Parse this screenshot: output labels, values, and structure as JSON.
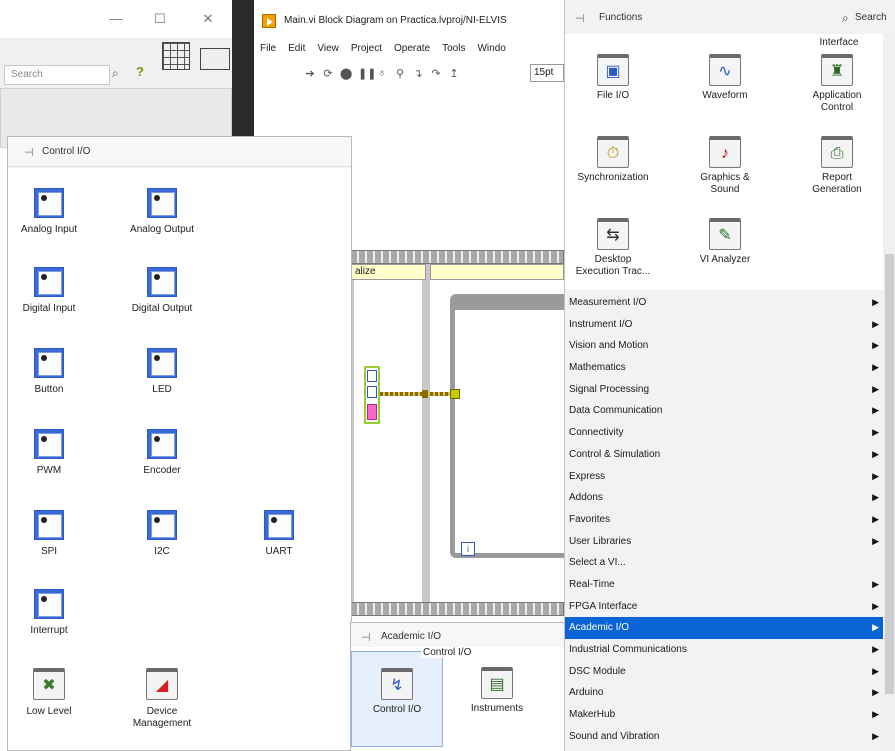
{
  "left_window": {
    "search_placeholder": "Search",
    "min_icon": "minimize-icon",
    "max_icon": "maximize-icon",
    "close_icon": "close-icon"
  },
  "block_diagram": {
    "title": "Main.vi Block Diagram on Practica.lvproj/NI-ELVIS",
    "menus": [
      "File",
      "Edit",
      "View",
      "Project",
      "Operate",
      "Tools",
      "Windo"
    ],
    "font_size": "15pt",
    "frame1_label": "alize",
    "loop_iteration": "i"
  },
  "control_palette": {
    "title": "Control I/O",
    "items": [
      {
        "label": "Analog Input",
        "glyph": "⌁"
      },
      {
        "label": "Analog Output",
        "glyph": "⌁"
      },
      {
        "label": "Digital Input",
        "glyph": "⊓"
      },
      {
        "label": "Digital Output",
        "glyph": "⊓"
      },
      {
        "label": "Button",
        "glyph": "●"
      },
      {
        "label": "LED",
        "glyph": "●"
      },
      {
        "label": "PWM",
        "glyph": "⊓"
      },
      {
        "label": "Encoder",
        "glyph": "E/D"
      },
      {
        "label": "SPI",
        "glyph": "SPI"
      },
      {
        "label": "I2C",
        "glyph": "I2C"
      },
      {
        "label": "UART",
        "glyph": "UART"
      },
      {
        "label": "Interrupt",
        "glyph": "IRQ"
      }
    ],
    "folders": [
      {
        "label": "Low Level"
      },
      {
        "label": "Device",
        "label2": "Management"
      }
    ]
  },
  "academic_palette": {
    "title": "Academic I/O",
    "tooltip": "Control I/O",
    "items": [
      {
        "label": "Control I/O"
      },
      {
        "label": "Instruments"
      }
    ]
  },
  "functions_palette": {
    "title": "Functions",
    "search_label": "Search",
    "top_label": "Interface",
    "grid_items": [
      {
        "label": "File I/O"
      },
      {
        "label": "Waveform"
      },
      {
        "label": "Application",
        "label2": "Control"
      },
      {
        "label": "Synchronization"
      },
      {
        "label": "Graphics &",
        "label2": "Sound"
      },
      {
        "label": "Report",
        "label2": "Generation"
      },
      {
        "label": "Desktop",
        "label2": "Execution Trac..."
      },
      {
        "label": "VI Analyzer"
      }
    ],
    "categories": [
      "Measurement I/O",
      "Instrument I/O",
      "Vision and Motion",
      "Mathematics",
      "Signal Processing",
      "Data Communication",
      "Connectivity",
      "Control & Simulation",
      "Express",
      "Addons",
      "Favorites",
      "User Libraries",
      "Select a VI...",
      "Real-Time",
      "FPGA Interface",
      "Academic I/O",
      "Industrial Communications",
      "DSC Module",
      "Arduino",
      "MakerHub",
      "Sound and Vibration"
    ],
    "selected_category": "Academic I/O",
    "selection_color": "#0a64d6"
  }
}
